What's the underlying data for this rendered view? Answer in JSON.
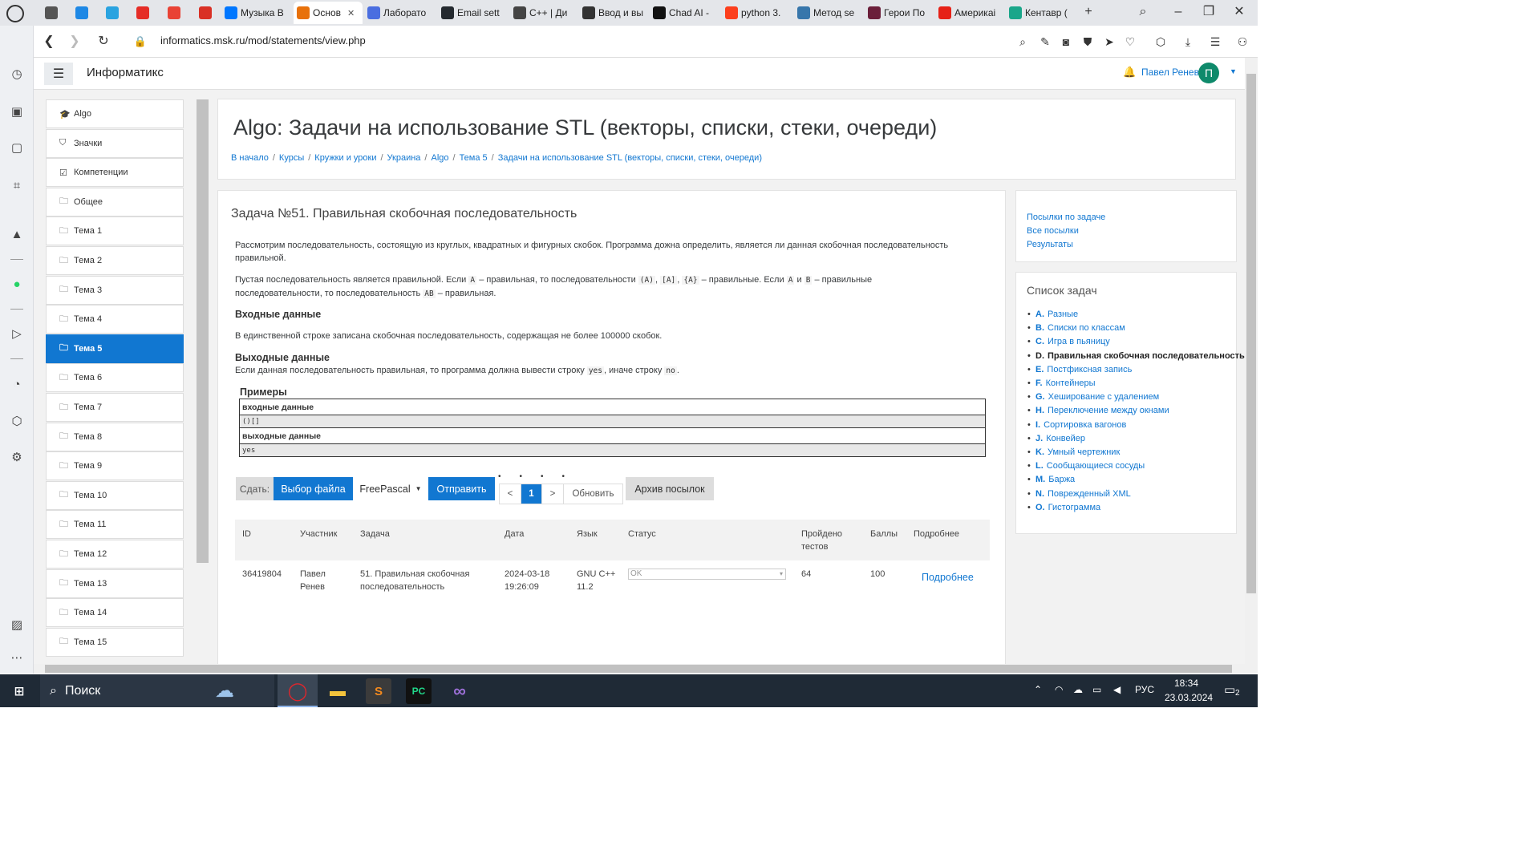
{
  "browser": {
    "tabs": [
      {
        "label": "",
        "color": "#555555"
      },
      {
        "label": "",
        "color": "#1e88e5"
      },
      {
        "label": "",
        "color": "#2aa3e0"
      },
      {
        "label": "",
        "color": "#e52d27"
      },
      {
        "label": "",
        "color": "#e94235"
      },
      {
        "label": "",
        "color": "#d93025"
      },
      {
        "label": "Музыка В",
        "color": "#0077ff"
      },
      {
        "label": "Основ",
        "color": "#e8710a"
      },
      {
        "label": "Лаборато",
        "color": "#4a6ee0"
      },
      {
        "label": "Email sett",
        "color": "#24292f"
      },
      {
        "label": "C++ | Ди",
        "color": "#444444"
      },
      {
        "label": "Ввод и вы",
        "color": "#333333"
      },
      {
        "label": "Chad AI -",
        "color": "#111111"
      },
      {
        "label": "python 3.",
        "color": "#fc3f1d"
      },
      {
        "label": "Метод se",
        "color": "#3776ab"
      },
      {
        "label": "Герои По",
        "color": "#6b1f3a"
      },
      {
        "label": "Америкаі",
        "color": "#e62117"
      },
      {
        "label": "Кентавр (",
        "color": "#1aa68a"
      }
    ],
    "url": "informatics.msk.ru/mod/statements/view.php"
  },
  "navbar": {
    "brand": "Информатикс",
    "user_name": "Павел Ренев",
    "avatar_letter": "П"
  },
  "drawer": {
    "items": [
      {
        "label": "Algo",
        "icon": "graduation-cap-icon",
        "glyph": "🎓"
      },
      {
        "label": "Значки",
        "icon": "shield-icon",
        "glyph": "⛉"
      },
      {
        "label": "Компетенции",
        "icon": "checkbox-icon",
        "glyph": "☑"
      },
      {
        "label": "Общее",
        "icon": "folder-icon",
        "glyph": "🗀"
      },
      {
        "label": "Тема 1",
        "icon": "folder-icon",
        "glyph": "🗀"
      },
      {
        "label": "Тема 2",
        "icon": "folder-icon",
        "glyph": "🗀"
      },
      {
        "label": "Тема 3",
        "icon": "folder-icon",
        "glyph": "🗀"
      },
      {
        "label": "Тема 4",
        "icon": "folder-icon",
        "glyph": "🗀"
      },
      {
        "label": "Тема 5",
        "icon": "folder-icon",
        "glyph": "🗀",
        "active": true
      },
      {
        "label": "Тема 6",
        "icon": "folder-icon",
        "glyph": "🗀"
      },
      {
        "label": "Тема 7",
        "icon": "folder-icon",
        "glyph": "🗀"
      },
      {
        "label": "Тема 8",
        "icon": "folder-icon",
        "glyph": "🗀"
      },
      {
        "label": "Тема 9",
        "icon": "folder-icon",
        "glyph": "🗀"
      },
      {
        "label": "Тема 10",
        "icon": "folder-icon",
        "glyph": "🗀"
      },
      {
        "label": "Тема 11",
        "icon": "folder-icon",
        "glyph": "🗀"
      },
      {
        "label": "Тема 12",
        "icon": "folder-icon",
        "glyph": "🗀"
      },
      {
        "label": "Тема 13",
        "icon": "folder-icon",
        "glyph": "🗀"
      },
      {
        "label": "Тема 14",
        "icon": "folder-icon",
        "glyph": "🗀"
      },
      {
        "label": "Тема 15",
        "icon": "folder-icon",
        "glyph": "🗀"
      }
    ]
  },
  "header": {
    "title": "Algo: Задачи на использование STL (векторы, списки, стеки, очереди)",
    "breadcrumbs": [
      "В начало",
      "Курсы",
      "Кружки и уроки",
      "Украина",
      "Algo",
      "Тема 5",
      "Задачи на использование STL (векторы, списки, стеки, очереди)"
    ]
  },
  "problem": {
    "title": "Задача №51. Правильная скобочная последовательность",
    "intro": "Рассмотрим последовательность, состоящую из круглых, квадратных и фигурных скобок. Программа дожна определить, является ли данная скобочная последовательность правильной.",
    "rules": {
      "p1": "Пустая последовательность является правильной. Если",
      "a1": "A",
      "p2": "– правильная, то последовательности",
      "c1": "(A)",
      "c2": "[A]",
      "c3": "{A}",
      "p3": "– правильные. Если",
      "a2": "A",
      "p4": "и",
      "b1": "B",
      "p5": "– правильные последовательности, то последовательность",
      "ab": "AB",
      "p6": "– правильная."
    },
    "input_heading": "Входные данные",
    "input_text": "В единственной строке записана скобочная последовательность, содержащая не более 100000 скобок.",
    "output_heading": "Выходные данные",
    "output_text": {
      "p1": "Если данная последовательность правильная, то программа должна вывести строку",
      "yes": "yes",
      "p2": ", иначе строку",
      "no": "no",
      "p3": "."
    },
    "examples_heading": "Примеры",
    "examples": {
      "input_label": "входные данные",
      "input_value": "()[]",
      "output_label": "выходные данные",
      "output_value": "yes"
    }
  },
  "submit": {
    "label": "Сдать:",
    "choose_file": "Выбор файла",
    "language": "FreePascal",
    "send": "Отправить",
    "pager_prev": "<",
    "pager_current": "1",
    "pager_next": ">",
    "refresh": "Обновить",
    "archive": "Архив посылок"
  },
  "results": {
    "columns": [
      "ID",
      "Участник",
      "Задача",
      "Дата",
      "Язык",
      "Статус",
      "Пройдено тестов",
      "Баллы",
      "Подробнее"
    ],
    "rows": [
      {
        "id": "36419804",
        "participant": "Павел Ренев",
        "task": "51. Правильная скобочная последовательность",
        "date": "2024-03-18 19:26:09",
        "language": "GNU C++ 11.2",
        "status": "OK",
        "tests": "64",
        "score": "100",
        "details": "Подробнее"
      }
    ]
  },
  "right": {
    "links": [
      "Посылки по задаче",
      "Все посылки",
      "Результаты"
    ],
    "tasklist_title": "Список задач",
    "tasks": [
      {
        "letter": "A.",
        "name": "Разные"
      },
      {
        "letter": "B.",
        "name": "Списки по классам"
      },
      {
        "letter": "C.",
        "name": "Игра в пьяницу"
      },
      {
        "letter": "D.",
        "name": "Правильная скобочная последовательность",
        "current": true
      },
      {
        "letter": "E.",
        "name": "Постфиксная запись"
      },
      {
        "letter": "F.",
        "name": "Контейнеры"
      },
      {
        "letter": "G.",
        "name": "Хеширование с удалением"
      },
      {
        "letter": "H.",
        "name": "Переключение между окнами"
      },
      {
        "letter": "I.",
        "name": "Сортировка вагонов"
      },
      {
        "letter": "J.",
        "name": "Конвейер"
      },
      {
        "letter": "K.",
        "name": "Умный чертежник"
      },
      {
        "letter": "L.",
        "name": "Сообщающиеся сосуды"
      },
      {
        "letter": "M.",
        "name": "Баржа"
      },
      {
        "letter": "N.",
        "name": "Поврежденный XML"
      },
      {
        "letter": "O.",
        "name": "Гистограмма"
      }
    ]
  },
  "taskbar": {
    "search": "Поиск",
    "lang": "РУС",
    "time": "18:34",
    "date": "23.03.2024",
    "notifications": "2"
  }
}
